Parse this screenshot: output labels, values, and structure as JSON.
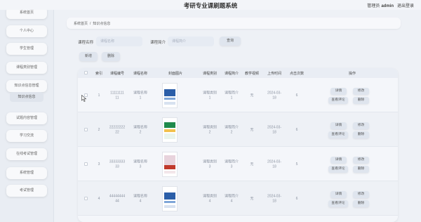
{
  "app": {
    "title": "考研专业课刷题系统"
  },
  "user": {
    "role": "管理员",
    "name": "admin",
    "logout": "退出登录"
  },
  "sidebar": {
    "items": [
      {
        "label": "系统首页"
      },
      {
        "label": "个人中心"
      },
      {
        "label": "学生管理"
      },
      {
        "label": "课程类别管理"
      },
      {
        "label": "知识点信息管理"
      },
      {
        "label": "试题内容管理"
      },
      {
        "label": "学习交流"
      },
      {
        "label": "在线考试管理"
      },
      {
        "label": "系统管理"
      },
      {
        "label": "考试管理"
      }
    ],
    "sub_item": "知识点信息"
  },
  "breadcrumb": {
    "home": "系统首页",
    "separator": "/",
    "current": "知识点信息"
  },
  "search": {
    "course_name_label": "课程名称",
    "course_name_placeholder": "课程名称",
    "course_intro_label": "课程简介",
    "course_intro_placeholder": "课程简介",
    "query_button": "查询"
  },
  "toolbar": {
    "add_button": "新增",
    "delete_button": "删除"
  },
  "table": {
    "headers": [
      "索引",
      "课程编号",
      "课程名称",
      "封面图片",
      "课程类别",
      "课程简介",
      "教学视频",
      "上传时间",
      "点击次数",
      "操作"
    ],
    "rows": [
      {
        "index": "1",
        "code": "11111111\n11",
        "name": "课程名称\n1",
        "category": "课程类别\n1",
        "intro": "课程简介\n1",
        "video": "无",
        "time": "2024-03-\n18",
        "clicks": "6"
      },
      {
        "index": "2",
        "code": "22222222\n22",
        "name": "课程名称\n2",
        "category": "课程类别\n2",
        "intro": "课程简介\n2",
        "video": "无",
        "time": "2024-03-\n18",
        "clicks": "6"
      },
      {
        "index": "3",
        "code": "33333333\n33",
        "name": "课程名称\n3",
        "category": "课程类别\n3",
        "intro": "课程简介\n3",
        "video": "无",
        "time": "2024-03-\n18",
        "clicks": "5"
      },
      {
        "index": "4",
        "code": "44444444\n44",
        "name": "课程名称\n4",
        "category": "课程类别\n4",
        "intro": "课程简介\n4",
        "video": "无",
        "time": "2024-03-\n18",
        "clicks": "6"
      }
    ],
    "row_actions": {
      "detail": "详情",
      "edit": "修改",
      "view_comments": "查看评论",
      "delete": "删除"
    }
  },
  "colors": {
    "cover_blue": "#2b5ea8",
    "cover_green": "#1f8a4c",
    "cover_red": "#c0392b",
    "nav_bg": "#e9edf3"
  }
}
